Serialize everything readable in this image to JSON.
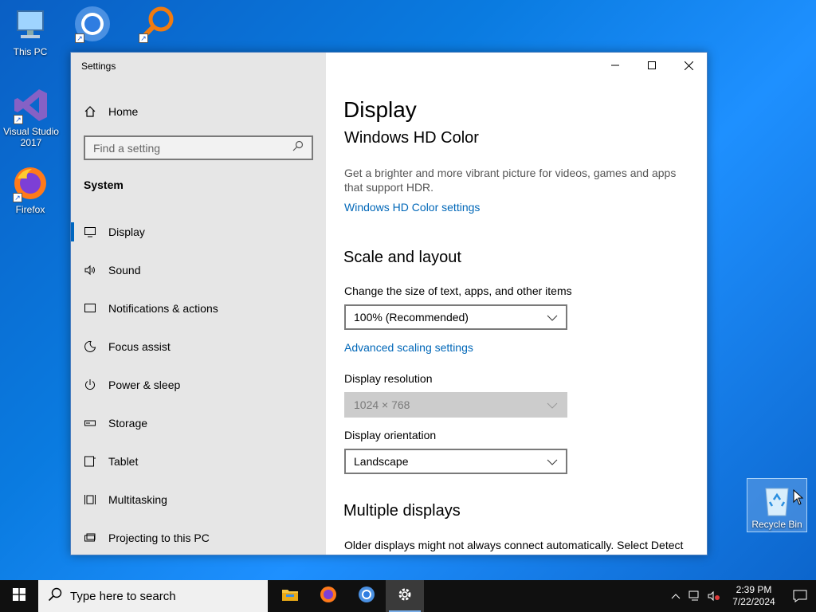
{
  "desktop": {
    "icons": [
      {
        "label": "This PC"
      },
      {
        "label": "Chrome"
      },
      {
        "label": "Everything"
      },
      {
        "label": "Visual Studio 2017"
      },
      {
        "label": "Firefox"
      }
    ],
    "recycle_bin": "Recycle Bin"
  },
  "window": {
    "title": "Settings",
    "controls": {
      "minimize": "minimize",
      "maximize": "maximize",
      "close": "close"
    }
  },
  "sidebar": {
    "home": "Home",
    "search_placeholder": "Find a setting",
    "section": "System",
    "items": [
      {
        "label": "Display",
        "icon": "monitor-icon",
        "active": true
      },
      {
        "label": "Sound",
        "icon": "speaker-icon"
      },
      {
        "label": "Notifications & actions",
        "icon": "notification-icon"
      },
      {
        "label": "Focus assist",
        "icon": "moon-icon"
      },
      {
        "label": "Power & sleep",
        "icon": "power-icon"
      },
      {
        "label": "Storage",
        "icon": "storage-icon"
      },
      {
        "label": "Tablet",
        "icon": "tablet-icon"
      },
      {
        "label": "Multitasking",
        "icon": "multitasking-icon"
      },
      {
        "label": "Projecting to this PC",
        "icon": "projector-icon"
      }
    ]
  },
  "content": {
    "title": "Display",
    "hd_color": {
      "heading": "Windows HD Color",
      "description": "Get a brighter and more vibrant picture for videos, games and apps that support HDR.",
      "link": "Windows HD Color settings"
    },
    "scale": {
      "heading": "Scale and layout",
      "size_label": "Change the size of text, apps, and other items",
      "size_value": "100% (Recommended)",
      "advanced_link": "Advanced scaling settings",
      "resolution_label": "Display resolution",
      "resolution_value": "1024 × 768",
      "orientation_label": "Display orientation",
      "orientation_value": "Landscape"
    },
    "multiple": {
      "heading": "Multiple displays",
      "description": "Older displays might not always connect automatically. Select Detect"
    }
  },
  "taskbar": {
    "search_placeholder": "Type here to search",
    "time": "2:39 PM",
    "date": "7/22/2024"
  },
  "colors": {
    "accent": "#0067c0",
    "link": "#0067b8",
    "taskbar": "#101010"
  }
}
